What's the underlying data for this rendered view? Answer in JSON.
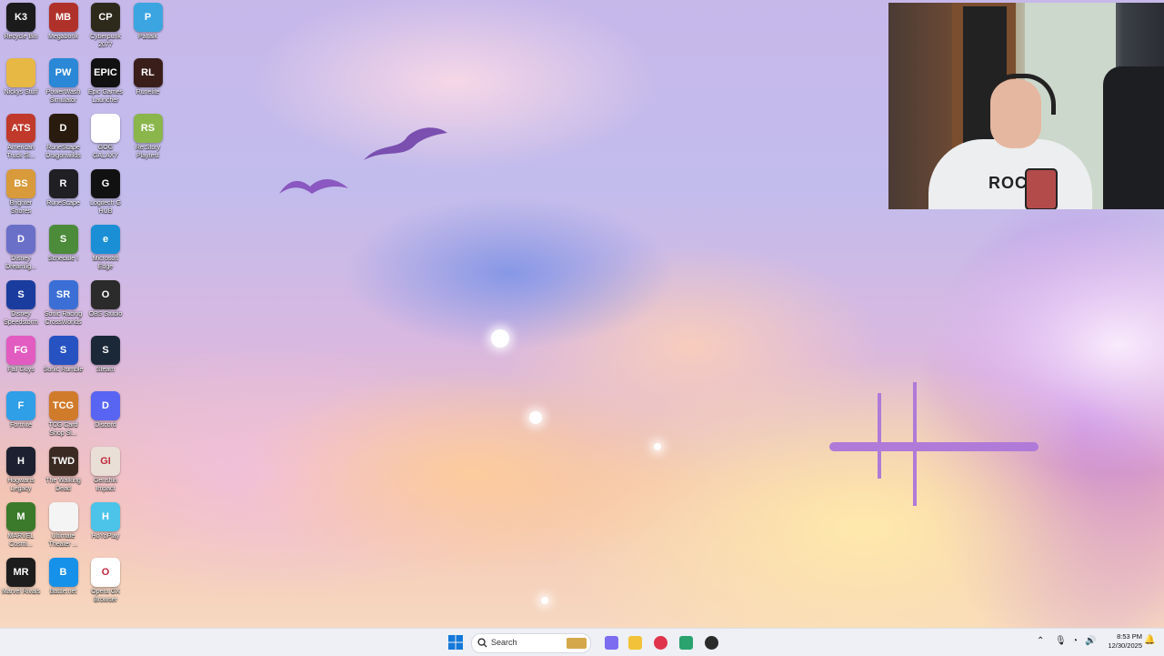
{
  "desktop": {
    "icons": [
      {
        "label": "Recycle Bin",
        "icon": "k3-icon",
        "color": "#1b1b1b",
        "glyph": "K3",
        "col": 0,
        "row": 0
      },
      {
        "label": "Megabonk",
        "icon": "megabonk-icon",
        "color": "#b0302a",
        "glyph": "MB",
        "col": 1,
        "row": 0
      },
      {
        "label": "Cyberpunk 2077",
        "icon": "cyberpunk-icon",
        "color": "#2d2a1c",
        "glyph": "CP",
        "col": 2,
        "row": 0
      },
      {
        "label": "Paltalk",
        "icon": "paltalk-icon",
        "color": "#3aa5e0",
        "glyph": "P",
        "col": 3,
        "row": 0
      },
      {
        "label": "Nickys Stuff",
        "icon": "folder-icon",
        "color": "#e7b844",
        "glyph": "",
        "col": 0,
        "row": 1
      },
      {
        "label": "PowerWash Simulator",
        "icon": "powerwash-icon",
        "color": "#2a88d6",
        "glyph": "PW",
        "col": 1,
        "row": 1
      },
      {
        "label": "Epic Games Launcher",
        "icon": "epic-games-icon",
        "color": "#111111",
        "glyph": "EPIC",
        "col": 2,
        "row": 1
      },
      {
        "label": "Runelite",
        "icon": "runelite-icon",
        "color": "#3a1e1a",
        "glyph": "RL",
        "col": 3,
        "row": 1
      },
      {
        "label": "American Truck Si...",
        "icon": "american-truck-icon",
        "color": "#c0392b",
        "glyph": "ATS",
        "col": 0,
        "row": 2
      },
      {
        "label": "RuneScape Dragonwilds",
        "icon": "runescape-dragonwilds-icon",
        "color": "#2a1b0f",
        "glyph": "D",
        "col": 1,
        "row": 2
      },
      {
        "label": "GOG GALAXY",
        "icon": "gog-galaxy-icon",
        "color": "#ffffff",
        "glyph": "",
        "col": 2,
        "row": 2
      },
      {
        "label": "Re:Story Playtest",
        "icon": "restory-icon",
        "color": "#8bb64c",
        "glyph": "RS",
        "col": 3,
        "row": 2
      },
      {
        "label": "Brighter Shores",
        "icon": "brighter-shores-icon",
        "color": "#d89a3a",
        "glyph": "BS",
        "col": 0,
        "row": 3
      },
      {
        "label": "RuneScape",
        "icon": "runescape-icon",
        "color": "#1f1f24",
        "glyph": "R",
        "col": 1,
        "row": 3
      },
      {
        "label": "Logitech G HUB",
        "icon": "logitech-ghub-icon",
        "color": "#111111",
        "glyph": "G",
        "col": 2,
        "row": 3
      },
      {
        "label": "Disney Dreamlig...",
        "icon": "disney-dreamlight-icon",
        "color": "#6a6fc8",
        "glyph": "D",
        "col": 0,
        "row": 4
      },
      {
        "label": "Schedule I",
        "icon": "schedule-one-icon",
        "color": "#4c8b3a",
        "glyph": "S",
        "col": 1,
        "row": 4
      },
      {
        "label": "Microsoft Edge",
        "icon": "edge-icon",
        "color": "#1a8fd6",
        "glyph": "e",
        "col": 2,
        "row": 4
      },
      {
        "label": "Disney Speedstorm",
        "icon": "disney-speedstorm-icon",
        "color": "#1a3c9e",
        "glyph": "S",
        "col": 0,
        "row": 5
      },
      {
        "label": "Sonic Racing CrossWorlds",
        "icon": "sonic-racing-icon",
        "color": "#3b6fd6",
        "glyph": "SR",
        "col": 1,
        "row": 5
      },
      {
        "label": "OBS Studio",
        "icon": "obs-icon",
        "color": "#2b2b2b",
        "glyph": "O",
        "col": 2,
        "row": 5
      },
      {
        "label": "Fall Guys",
        "icon": "fall-guys-icon",
        "color": "#e25bc0",
        "glyph": "FG",
        "col": 0,
        "row": 6
      },
      {
        "label": "Sonic Rumble",
        "icon": "sonic-rumble-icon",
        "color": "#2652c2",
        "glyph": "S",
        "col": 1,
        "row": 6
      },
      {
        "label": "Steam",
        "icon": "steam-icon",
        "color": "#1b2838",
        "glyph": "S",
        "col": 2,
        "row": 6
      },
      {
        "label": "Fortnite",
        "icon": "fortnite-icon",
        "color": "#2f9fe8",
        "glyph": "F",
        "col": 0,
        "row": 7
      },
      {
        "label": "TCG Card Shop Si...",
        "icon": "tcg-card-shop-icon",
        "color": "#d07b2a",
        "glyph": "TCG",
        "col": 1,
        "row": 7
      },
      {
        "label": "Discord",
        "icon": "discord-icon",
        "color": "#5865f2",
        "glyph": "D",
        "col": 2,
        "row": 7
      },
      {
        "label": "Hogwarts Legacy",
        "icon": "hogwarts-legacy-icon",
        "color": "#1c2030",
        "glyph": "H",
        "col": 0,
        "row": 8
      },
      {
        "label": "The Walking Dead",
        "icon": "walking-dead-icon",
        "color": "#3b2a22",
        "glyph": "TWD",
        "col": 1,
        "row": 8
      },
      {
        "label": "Genshin Impact",
        "icon": "genshin-impact-icon",
        "color": "#e9dfd6",
        "glyph": "GI",
        "col": 2,
        "row": 8
      },
      {
        "label": "MARVEL Cosmi...",
        "icon": "marvel-cosmic-icon",
        "color": "#3a7a2a",
        "glyph": "M",
        "col": 0,
        "row": 9
      },
      {
        "label": "Ultimate Theater ...",
        "icon": "ultimate-theater-icon",
        "color": "#f4f4f4",
        "glyph": "",
        "col": 1,
        "row": 9
      },
      {
        "label": "HoYoPlay",
        "icon": "hoyoplay-icon",
        "color": "#4cc3e8",
        "glyph": "H",
        "col": 2,
        "row": 9
      },
      {
        "label": "Marvel Rivals",
        "icon": "marvel-rivals-icon",
        "color": "#1d1d1d",
        "glyph": "MR",
        "col": 0,
        "row": 10
      },
      {
        "label": "Battle.net",
        "icon": "battlenet-icon",
        "color": "#1591ea",
        "glyph": "B",
        "col": 1,
        "row": 10
      },
      {
        "label": "Opera GX Browser",
        "icon": "opera-gx-icon",
        "color": "#ffffff",
        "glyph": "O",
        "col": 2,
        "row": 10
      }
    ]
  },
  "webcam": {
    "shirt_text": "ROCK"
  },
  "taskbar": {
    "search_placeholder": "Search",
    "pinned": [
      {
        "name": "widgets-icon",
        "color": "#d4a84a"
      },
      {
        "name": "copilot-icon",
        "color": "#7b6cf0"
      },
      {
        "name": "file-explorer-icon",
        "color": "#f2c23a"
      },
      {
        "name": "opera-gx-taskbar-icon",
        "color": "#e0344c"
      },
      {
        "name": "notepad-icon",
        "color": "#2aa36f"
      },
      {
        "name": "obs-taskbar-icon",
        "color": "#2b2b2b"
      }
    ],
    "clock": {
      "time": "8:53 PM",
      "date": "12/30/2025"
    }
  }
}
